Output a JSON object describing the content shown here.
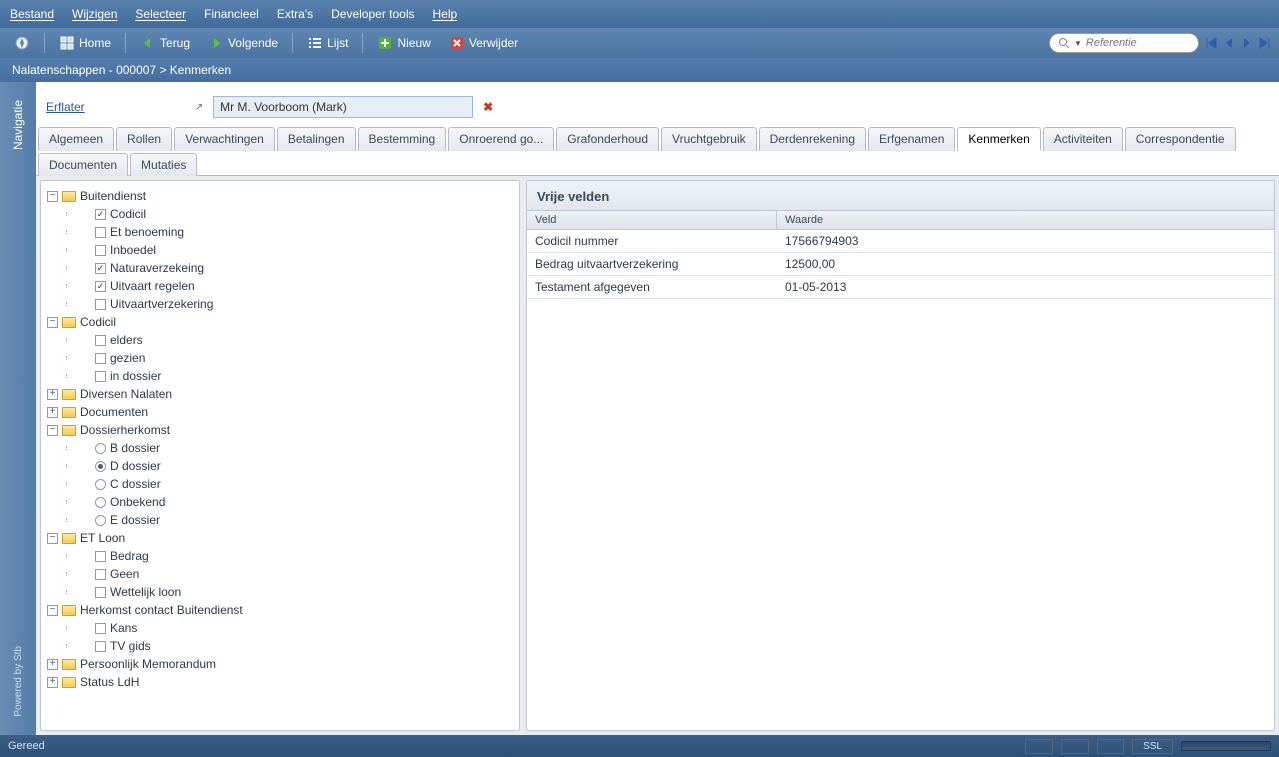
{
  "menu": [
    "Bestand",
    "Wijzigen",
    "Selecteer",
    "Financieel",
    "Extra's",
    "Developer tools",
    "Help"
  ],
  "toolbar": {
    "home": "Home",
    "back": "Terug",
    "forward": "Volgende",
    "list": "Lijst",
    "new": "Nieuw",
    "delete": "Verwijder",
    "search_placeholder": "Referentie"
  },
  "breadcrumb": "Nalatenschappen - 000007 > Kenmerken",
  "side_tab": "Navigatie",
  "side_bottom": "Powered by Stb",
  "header": {
    "label": "Erflater",
    "value": "Mr M. Voorboom (Mark)"
  },
  "tabs": [
    "Algemeen",
    "Rollen",
    "Verwachtingen",
    "Betalingen",
    "Bestemming",
    "Onroerend go...",
    "Grafonderhoud",
    "Vruchtgebruik",
    "Derdenrekening",
    "Erfgenamen",
    "Kenmerken",
    "Activiteiten",
    "Correspondentie",
    "Documenten",
    "Mutaties"
  ],
  "active_tab": "Kenmerken",
  "grid": {
    "title": "Vrije velden",
    "columns": [
      "Veld",
      "Waarde"
    ],
    "rows": [
      {
        "k": "Codicil nummer",
        "v": "17566794903"
      },
      {
        "k": "Bedrag uitvaartverzekering",
        "v": "12500,00"
      },
      {
        "k": "Testament afgegeven",
        "v": "01-05-2013"
      }
    ]
  },
  "tree": {
    "buitendienst": {
      "label": "Buitendienst",
      "children": [
        {
          "label": "Codicil",
          "type": "cb",
          "checked": true
        },
        {
          "label": "Et benoeming",
          "type": "cb",
          "checked": false
        },
        {
          "label": "Inboedel",
          "type": "cb",
          "checked": false
        },
        {
          "label": "Naturaverzekeing",
          "type": "cb",
          "checked": true
        },
        {
          "label": "Uitvaart regelen",
          "type": "cb",
          "checked": true
        },
        {
          "label": "Uitvaartverzekering",
          "type": "cb",
          "checked": false
        }
      ]
    },
    "codicil": {
      "label": "Codicil",
      "children": [
        {
          "label": "elders",
          "type": "cb",
          "checked": false
        },
        {
          "label": "gezien",
          "type": "cb",
          "checked": false
        },
        {
          "label": "in dossier",
          "type": "cb",
          "checked": false
        }
      ]
    },
    "diversen": {
      "label": "Diversen Nalaten"
    },
    "documenten": {
      "label": "Documenten"
    },
    "dossierherkomst": {
      "label": "Dossierherkomst",
      "children": [
        {
          "label": "B dossier",
          "type": "rb",
          "checked": false
        },
        {
          "label": "D dossier",
          "type": "rb",
          "checked": true
        },
        {
          "label": "C dossier",
          "type": "rb",
          "checked": false
        },
        {
          "label": "Onbekend",
          "type": "rb",
          "checked": false
        },
        {
          "label": "E dossier",
          "type": "rb",
          "checked": false
        }
      ]
    },
    "etloon": {
      "label": "ET Loon",
      "children": [
        {
          "label": "Bedrag",
          "type": "cb",
          "checked": false
        },
        {
          "label": "Geen",
          "type": "cb",
          "checked": false
        },
        {
          "label": "Wettelijk loon",
          "type": "cb",
          "checked": false
        }
      ]
    },
    "herkomst": {
      "label": "Herkomst contact Buitendienst",
      "children": [
        {
          "label": "Kans",
          "type": "cb",
          "checked": false
        },
        {
          "label": "TV gids",
          "type": "cb",
          "checked": false
        }
      ]
    },
    "memorandum": {
      "label": "Persoonlijk Memorandum"
    },
    "status": {
      "label": "Status LdH"
    }
  },
  "status": {
    "left": "Gereed",
    "ssl": "SSL"
  }
}
